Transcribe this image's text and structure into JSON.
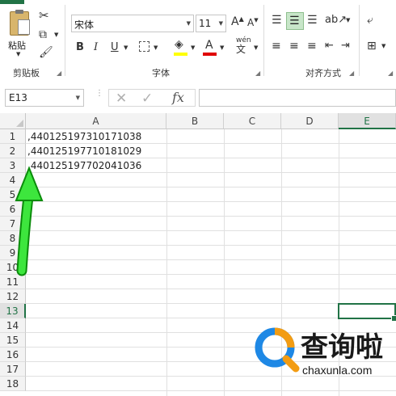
{
  "ribbon": {
    "paste_label": "粘贴",
    "clipboard_label": "剪贴板",
    "font_name": "宋体",
    "font_size": "11",
    "bold": "B",
    "italic": "I",
    "underline": "U",
    "phonetic": "wén",
    "font_label": "字体",
    "alignment_label": "对齐方式"
  },
  "formula_bar": {
    "name_box": "E13",
    "fx": "fx",
    "formula": ""
  },
  "sheet": {
    "columns": [
      "A",
      "B",
      "C",
      "D",
      "E"
    ],
    "rows": [
      "1",
      "2",
      "3",
      "4",
      "5",
      "6",
      "7",
      "8",
      "9",
      "10",
      "11",
      "12",
      "13",
      "14",
      "15",
      "16",
      "17",
      "18"
    ],
    "cells": [
      ",440125197310171038",
      ",440125197710181029",
      ",440125197702041036"
    ],
    "selected_cell": "E13"
  },
  "watermark": {
    "brand": "查询啦",
    "url": "chaxunla.com"
  },
  "colors": {
    "accent_green": "#217346",
    "arrow_green": "#2ecc2e"
  }
}
